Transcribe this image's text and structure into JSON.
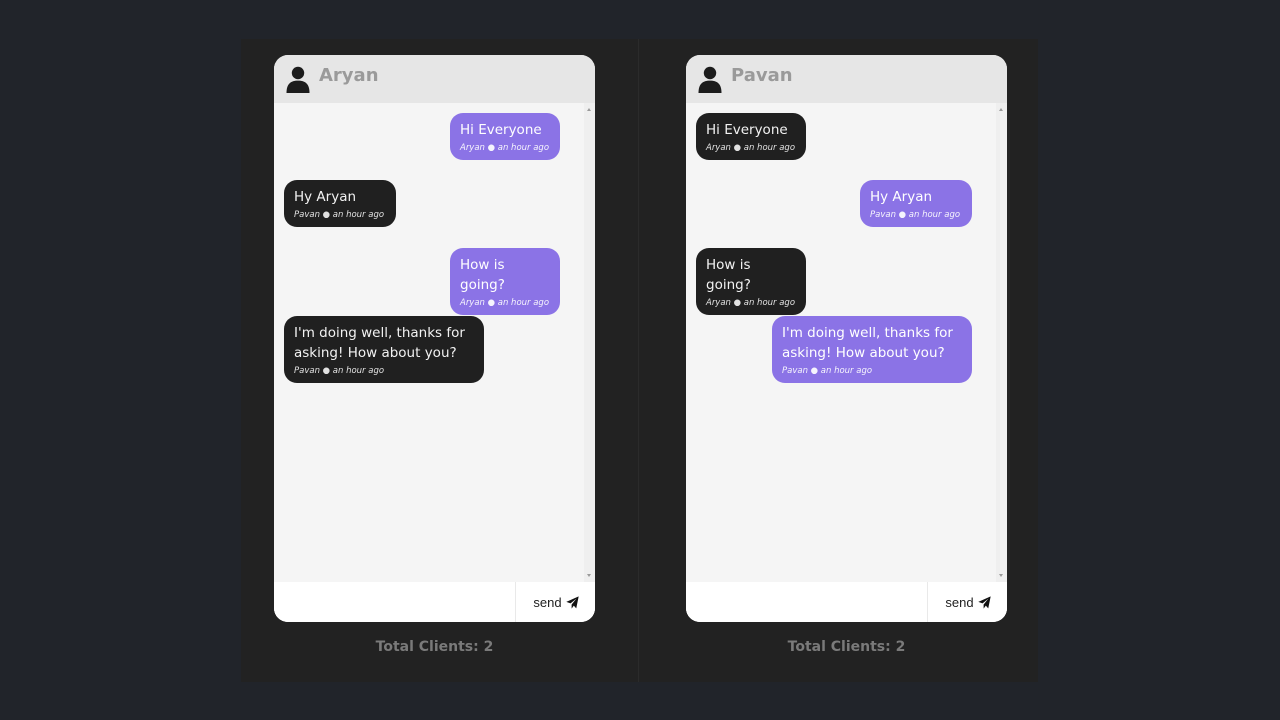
{
  "left_panel": {
    "user_name": "Aryan",
    "messages": [
      {
        "text": "Hi Everyone",
        "meta": "Aryan ● an hour ago",
        "style": "purple"
      },
      {
        "text": "Hy Aryan",
        "meta": "Pavan ● an hour ago",
        "style": "dark"
      },
      {
        "text": "How is going?",
        "meta": "Aryan ● an hour ago",
        "style": "purple"
      },
      {
        "text": "I'm doing well, thanks for asking! How about you?",
        "meta": "Pavan ● an hour ago",
        "style": "dark"
      }
    ],
    "input_value": "",
    "send_label": "send",
    "total_clients": "Total Clients: 2"
  },
  "right_panel": {
    "user_name": "Pavan",
    "messages": [
      {
        "text": "Hi Everyone",
        "meta": "Aryan ● an hour ago",
        "style": "dark"
      },
      {
        "text": "Hy Aryan",
        "meta": "Pavan ● an hour ago",
        "style": "purple"
      },
      {
        "text": "How is going?",
        "meta": "Aryan ● an hour ago",
        "style": "dark"
      },
      {
        "text": "I'm doing well, thanks for asking! How about you?",
        "meta": "Pavan ● an hour ago",
        "style": "purple"
      }
    ],
    "input_value": "",
    "send_label": "send",
    "total_clients": "Total Clients: 2"
  },
  "icons": {
    "user": "user-icon",
    "send": "paper-plane-icon"
  },
  "colors": {
    "page_background": "#21242a",
    "stage_background": "#222222",
    "chat_background": "#f5f5f5",
    "header_background": "#e6e6e6",
    "sent_bubble": "#8b73e6",
    "received_bubble": "#202020"
  }
}
